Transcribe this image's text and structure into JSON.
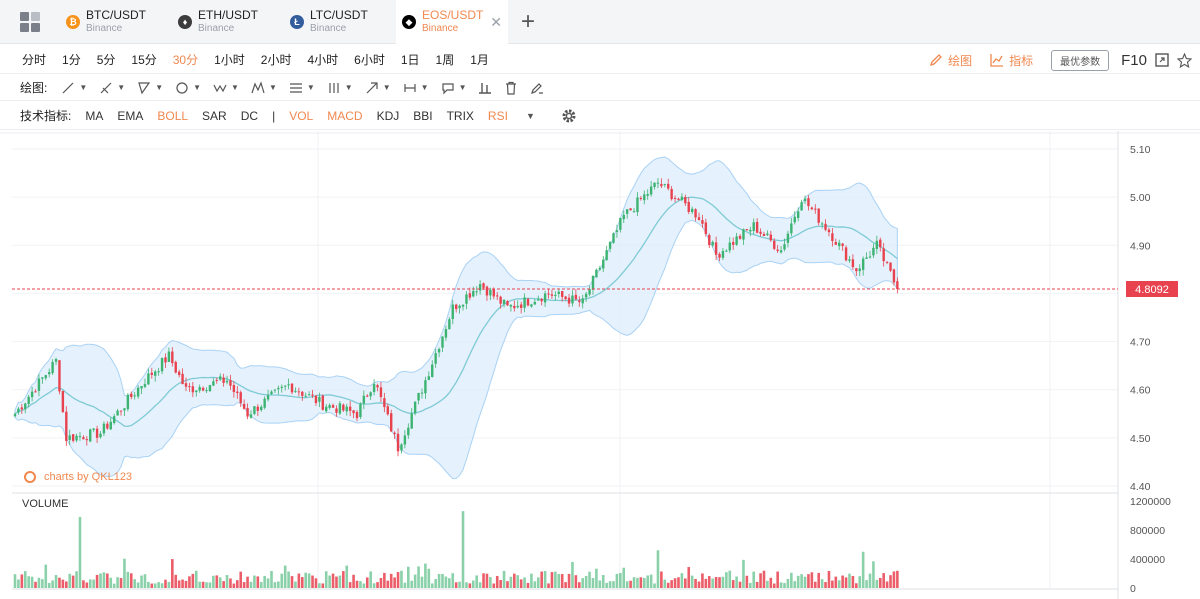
{
  "tabs": [
    {
      "pair": "BTC/USDT",
      "exchange": "Binance",
      "icon": "bitcoin-icon",
      "color": "#f7931a",
      "glyph": "₿"
    },
    {
      "pair": "ETH/USDT",
      "exchange": "Binance",
      "icon": "ethereum-icon",
      "color": "#3c3c3d",
      "glyph": "♦"
    },
    {
      "pair": "LTC/USDT",
      "exchange": "Binance",
      "icon": "litecoin-icon",
      "color": "#345d9d",
      "glyph": "Ł"
    },
    {
      "pair": "EOS/USDT",
      "exchange": "Binance",
      "icon": "eos-icon",
      "color": "#000000",
      "glyph": "◆"
    }
  ],
  "active_tab": 3,
  "periods": [
    "分时",
    "1分",
    "5分",
    "15分",
    "30分",
    "1小时",
    "2小时",
    "4小时",
    "6小时",
    "1日",
    "1周",
    "1月"
  ],
  "active_period": "30分",
  "right_tools": {
    "draw": "绘图",
    "indicator": "指标",
    "optimal": "最优参数",
    "f10": "F10"
  },
  "draw_label": "绘图:",
  "indicator_label": "技术指标:",
  "indicators_main": [
    {
      "name": "MA",
      "on": false
    },
    {
      "name": "EMA",
      "on": false
    },
    {
      "name": "BOLL",
      "on": true
    },
    {
      "name": "SAR",
      "on": false
    },
    {
      "name": "DC",
      "on": false
    }
  ],
  "indicators_sub": [
    {
      "name": "VOL",
      "on": true
    },
    {
      "name": "MACD",
      "on": true
    },
    {
      "name": "KDJ",
      "on": false
    },
    {
      "name": "BBI",
      "on": false
    },
    {
      "name": "TRIX",
      "on": false
    },
    {
      "name": "RSI",
      "on": true
    }
  ],
  "brand": "charts by QKL123",
  "colors": {
    "accent": "#f0884f",
    "up": "#3cb371",
    "down": "#e8424f",
    "boll_fill": "#dcecfb",
    "boll_mid": "#7ecbd6"
  },
  "chart_data": {
    "type": "candlestick",
    "price_axis": {
      "ticks": [
        "5.10",
        "5.00",
        "4.90",
        "4.80",
        "4.70",
        "4.60",
        "4.50",
        "4.40"
      ],
      "range": [
        4.4,
        5.1
      ]
    },
    "current_price": "4.8092",
    "volume_label": "VOLUME",
    "volume_axis": {
      "ticks": [
        "1200000",
        "800000",
        "400000",
        "0"
      ],
      "range": [
        0,
        1200000
      ]
    },
    "anchors": [
      [
        0,
        4.55
      ],
      [
        12,
        4.66
      ],
      [
        15,
        4.5
      ],
      [
        25,
        4.51
      ],
      [
        38,
        4.62
      ],
      [
        45,
        4.67
      ],
      [
        50,
        4.6
      ],
      [
        62,
        4.62
      ],
      [
        68,
        4.55
      ],
      [
        80,
        4.61
      ],
      [
        90,
        4.57
      ],
      [
        100,
        4.55
      ],
      [
        105,
        4.62
      ],
      [
        112,
        4.48
      ],
      [
        120,
        4.62
      ],
      [
        128,
        4.77
      ],
      [
        136,
        4.82
      ],
      [
        144,
        4.77
      ],
      [
        156,
        4.8
      ],
      [
        166,
        4.78
      ],
      [
        178,
        4.96
      ],
      [
        188,
        5.03
      ],
      [
        200,
        4.96
      ],
      [
        205,
        4.88
      ],
      [
        216,
        4.94
      ],
      [
        224,
        4.89
      ],
      [
        230,
        5.0
      ],
      [
        238,
        4.93
      ],
      [
        246,
        4.85
      ],
      [
        252,
        4.9
      ],
      [
        258,
        4.81
      ]
    ]
  }
}
